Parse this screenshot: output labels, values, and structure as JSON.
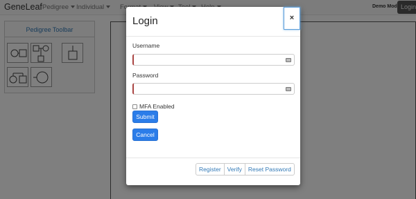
{
  "navbar": {
    "brand": "GeneLeaf",
    "menus": [
      "Pedigree",
      "Individual",
      "Format",
      "View",
      "Tool",
      "Help"
    ],
    "demo_mode": "Demo Mode",
    "login": "Login"
  },
  "toolbar": {
    "title": "Pedigree Toolbar",
    "tools": [
      "couple-icon",
      "parents-child-icon",
      "child-icon",
      "sibling-icon",
      "individual-icon"
    ]
  },
  "modal": {
    "title": "Login",
    "close": "×",
    "username_label": "Username",
    "username_value": "",
    "password_label": "Password",
    "password_value": "",
    "mfa_label": "MFA Enabled",
    "mfa_checked": false,
    "submit": "Submit",
    "cancel": "Cancel",
    "footer": {
      "register": "Register",
      "verify": "Verify",
      "reset_password": "Reset Password"
    }
  },
  "colors": {
    "primary": "#2b7de9",
    "link": "#337ab7",
    "invalid_border": "#a94442"
  }
}
